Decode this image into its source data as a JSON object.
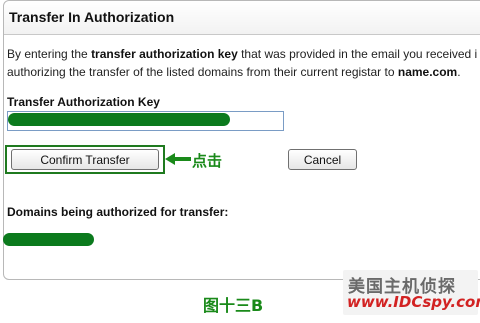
{
  "panel": {
    "title": "Transfer In Authorization",
    "intro_line1_pre": "By entering the ",
    "intro_line1_bold": "transfer authorization key",
    "intro_line1_post": " that was provided in the email you received i",
    "intro_line2_pre": "authorizing the transfer of the listed domains from their current registar to ",
    "intro_line2_bold": "name.com",
    "intro_line2_post": "."
  },
  "key_field": {
    "label": "Transfer Authorization Key",
    "value": ""
  },
  "buttons": {
    "confirm_label": "Confirm Transfer",
    "cancel_label": "Cancel"
  },
  "annotation": {
    "text": "点击",
    "color": "#1a8a1a"
  },
  "domains": {
    "label": "Domains being authorized for transfer:"
  },
  "redaction_color": "#0b7a1d",
  "watermark": {
    "line1": "美国主机侦探",
    "line2": "www.IDCspy.com"
  },
  "caption": "图十三B"
}
